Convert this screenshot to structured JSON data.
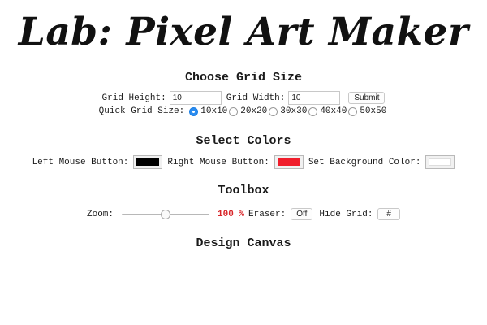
{
  "page": {
    "title": "Lab: Pixel Art Maker"
  },
  "grid_size": {
    "heading": "Choose Grid Size",
    "height_label": "Grid Height:",
    "height_value": "10",
    "width_label": "Grid Width:",
    "width_value": "10",
    "submit_label": "Submit",
    "quick_label": "Quick Grid Size:",
    "quick_options": [
      "10x10",
      "20x20",
      "30x30",
      "40x40",
      "50x50"
    ],
    "quick_selected": "10x10"
  },
  "colors": {
    "heading": "Select Colors",
    "left_label": "Left Mouse Button:",
    "left_color": "#000000",
    "right_label": "Right Mouse Button:",
    "right_color": "#f01d2b",
    "background_label": "Set Background Color:",
    "background_color": "#ffffff"
  },
  "toolbox": {
    "heading": "Toolbox",
    "zoom_label": "Zoom:",
    "zoom_value": "100 %",
    "zoom_fraction": 0.5,
    "eraser_label": "Eraser:",
    "eraser_button": "Off",
    "hide_grid_label": "Hide Grid:",
    "hide_grid_button": "#"
  },
  "canvas": {
    "heading": "Design Canvas"
  }
}
